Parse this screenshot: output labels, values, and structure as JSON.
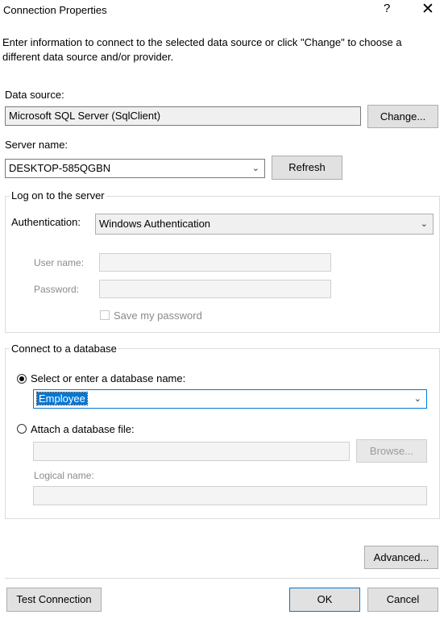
{
  "window": {
    "title": "Connection Properties",
    "help_glyph": "?",
    "close_glyph": "✕"
  },
  "intro_text": "Enter information to connect to the selected data source or click \"Change\" to choose a different data source and/or provider.",
  "data_source": {
    "label": "Data source:",
    "value": "Microsoft SQL Server (SqlClient)",
    "change_button": "Change..."
  },
  "server": {
    "label": "Server name:",
    "value": "DESKTOP-585QGBN",
    "refresh_button": "Refresh"
  },
  "logon": {
    "group_title": "Log on to the server",
    "auth_label": "Authentication:",
    "auth_value": "Windows Authentication",
    "user_label": "User name:",
    "password_label": "Password:",
    "save_password_label": "Save my password"
  },
  "database": {
    "group_title": "Connect to a database",
    "select_option_label": "Select or enter a database name:",
    "database_value": "Employee",
    "attach_option_label": "Attach a database file:",
    "browse_button": "Browse...",
    "logical_name_label": "Logical name:"
  },
  "footer": {
    "advanced_button": "Advanced...",
    "test_button": "Test Connection",
    "ok_button": "OK",
    "cancel_button": "Cancel"
  }
}
